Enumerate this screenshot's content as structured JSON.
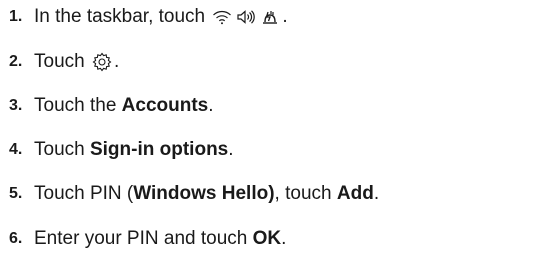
{
  "steps": [
    {
      "number": "1.",
      "text_before": "In the taskbar, touch ",
      "icons": [
        "wifi-icon",
        "speaker-volume-icon",
        "battery-charging-icon"
      ],
      "text_after": "."
    },
    {
      "number": "2.",
      "text_before": "Touch ",
      "icons": [
        "gear-icon"
      ],
      "text_after": "."
    },
    {
      "number": "3.",
      "text_before": "Touch the ",
      "bold": "Accounts",
      "text_after": "."
    },
    {
      "number": "4.",
      "text_before": "Touch ",
      "bold": "Sign-in options",
      "text_after": "."
    },
    {
      "number": "5.",
      "text_before": "Touch PIN (",
      "bold": "Windows Hello)",
      "text_middle": ", touch ",
      "bold2": "Add",
      "text_after": "."
    },
    {
      "number": "6.",
      "text_before": "Enter your PIN and touch ",
      "bold": "OK",
      "text_after": "."
    }
  ]
}
